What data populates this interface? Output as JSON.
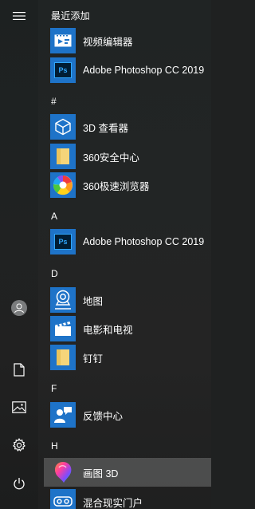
{
  "rail": {
    "menu_icon": "hamburger-icon",
    "user_icon": "user-icon",
    "documents_icon": "document-icon",
    "pictures_icon": "picture-icon",
    "settings_icon": "gear-icon",
    "power_icon": "power-icon"
  },
  "app_list": {
    "recent_header": "最近添加",
    "recent": [
      {
        "label": "视频编辑器",
        "icon": "video-editor-icon"
      },
      {
        "label": "Adobe Photoshop CC 2019",
        "icon": "photoshop-icon"
      }
    ],
    "groups": [
      {
        "letter": "#",
        "items": [
          {
            "label": "3D 查看器",
            "icon": "3d-viewer-icon"
          },
          {
            "label": "360安全中心",
            "icon": "folder-icon"
          },
          {
            "label": "360极速浏览器",
            "icon": "360-browser-icon"
          }
        ]
      },
      {
        "letter": "A",
        "items": [
          {
            "label": "Adobe Photoshop CC 2019",
            "icon": "photoshop-icon"
          }
        ]
      },
      {
        "letter": "D",
        "items": [
          {
            "label": "地图",
            "icon": "maps-icon"
          },
          {
            "label": "电影和电视",
            "icon": "movies-tv-icon"
          },
          {
            "label": "钉钉",
            "icon": "folder-icon"
          }
        ]
      },
      {
        "letter": "F",
        "items": [
          {
            "label": "反馈中心",
            "icon": "feedback-hub-icon"
          }
        ]
      },
      {
        "letter": "H",
        "items": [
          {
            "label": "画图 3D",
            "icon": "paint-3d-icon"
          },
          {
            "label": "混合现实门户",
            "icon": "mixed-reality-icon"
          }
        ]
      }
    ]
  },
  "colors": {
    "tile_blue": "#1e73c8",
    "background": "#212424",
    "hover": "#5a5c5c"
  }
}
